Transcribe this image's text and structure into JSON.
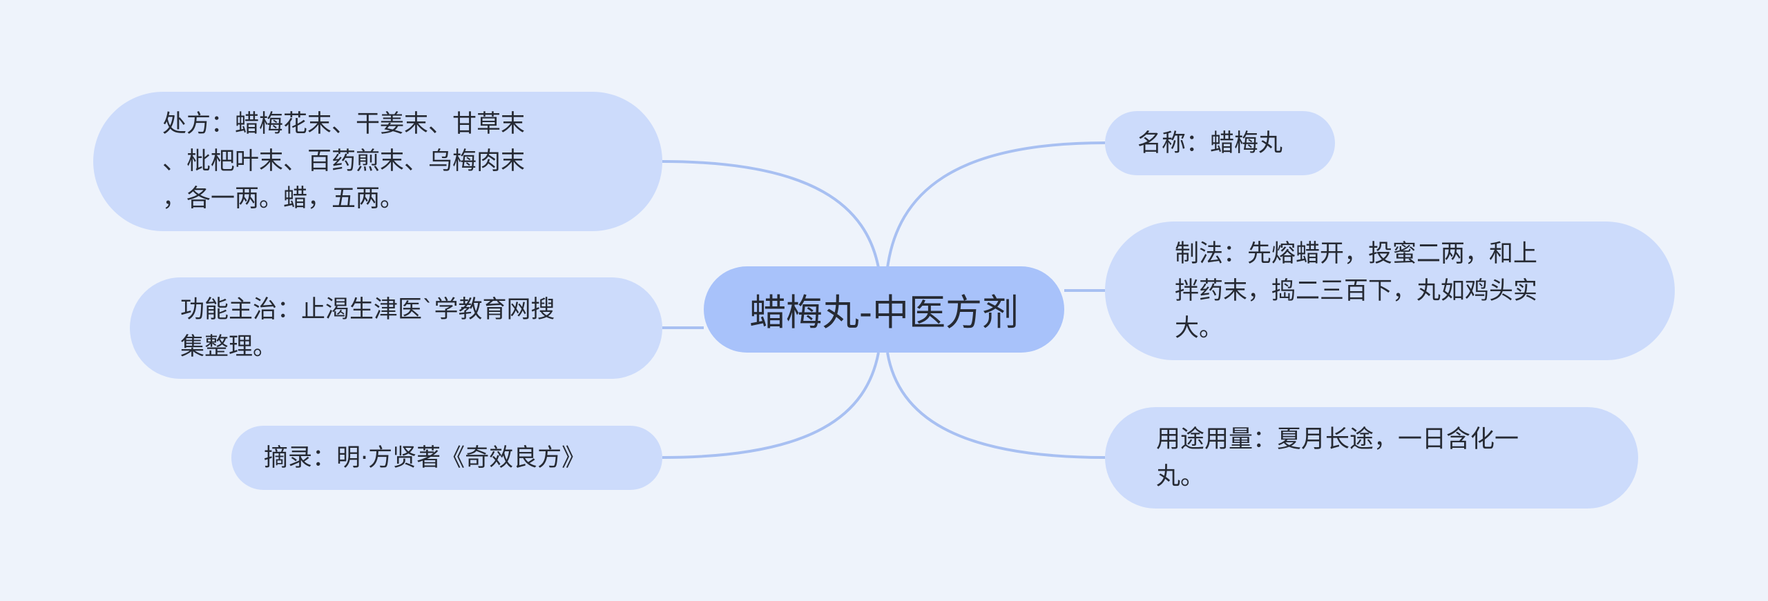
{
  "diagram": {
    "type": "mindmap",
    "colors": {
      "background": "#eef3fb",
      "central_fill": "#a8c2fa",
      "node_fill": "#ccdbfb",
      "link": "#a8c0f2",
      "text": "#262a33"
    },
    "central": {
      "label": "蜡梅丸-中医方剂"
    },
    "left_branches": [
      {
        "id": "prescription",
        "label": "处方：蜡梅花末、干姜末、甘草末\n、枇杷叶末、百药煎末、乌梅肉末\n，各一两。蜡，五两。"
      },
      {
        "id": "indications",
        "label": "功能主治：止渴生津医`学教育网搜\n集整理。"
      },
      {
        "id": "source",
        "label": "摘录：明·方贤著《奇效良方》"
      }
    ],
    "right_branches": [
      {
        "id": "name",
        "label": "名称：蜡梅丸"
      },
      {
        "id": "preparation",
        "label": "制法：先熔蜡开，投蜜二两，和上\n拌药末，捣二三百下，丸如鸡头实\n大。"
      },
      {
        "id": "usage",
        "label": "用途用量：夏月长途，一日含化一\n丸。"
      }
    ]
  }
}
